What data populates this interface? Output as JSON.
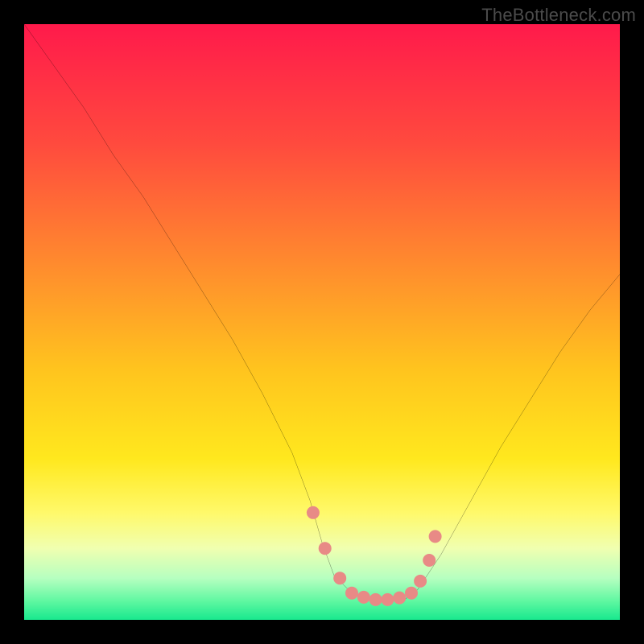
{
  "watermark": "TheBottleneck.com",
  "chart_data": {
    "type": "line",
    "title": "",
    "xlabel": "",
    "ylabel": "",
    "xlim": [
      0,
      100
    ],
    "ylim": [
      0,
      100
    ],
    "gradient_stops": [
      {
        "offset": 0,
        "color": "#ff1a4b"
      },
      {
        "offset": 0.2,
        "color": "#ff4a3e"
      },
      {
        "offset": 0.4,
        "color": "#ff8a2e"
      },
      {
        "offset": 0.58,
        "color": "#ffc41e"
      },
      {
        "offset": 0.73,
        "color": "#ffe81e"
      },
      {
        "offset": 0.82,
        "color": "#fff96a"
      },
      {
        "offset": 0.88,
        "color": "#f0ffb0"
      },
      {
        "offset": 0.93,
        "color": "#b6ffc0"
      },
      {
        "offset": 0.97,
        "color": "#5cf7a0"
      },
      {
        "offset": 1.0,
        "color": "#18e88e"
      }
    ],
    "series": [
      {
        "name": "curve",
        "color": "#000000",
        "x": [
          0,
          5,
          10,
          15,
          20,
          25,
          30,
          35,
          40,
          45,
          48,
          50,
          52,
          55,
          58,
          60,
          62,
          64,
          66,
          70,
          75,
          80,
          85,
          90,
          95,
          100
        ],
        "y": [
          100,
          93,
          86,
          78,
          71,
          63,
          55,
          47,
          38,
          28,
          20,
          13,
          7.5,
          4.5,
          3.5,
          3.3,
          3.3,
          3.5,
          5,
          11,
          20,
          29,
          37,
          45,
          52,
          58
        ]
      }
    ],
    "markers": {
      "color": "#e88a86",
      "radius": 8,
      "points": [
        {
          "x": 48.5,
          "y": 18
        },
        {
          "x": 50.5,
          "y": 12
        },
        {
          "x": 53,
          "y": 7
        },
        {
          "x": 55,
          "y": 4.5
        },
        {
          "x": 57,
          "y": 3.8
        },
        {
          "x": 59,
          "y": 3.4
        },
        {
          "x": 61,
          "y": 3.4
        },
        {
          "x": 63,
          "y": 3.7
        },
        {
          "x": 65,
          "y": 4.5
        },
        {
          "x": 66.5,
          "y": 6.5
        },
        {
          "x": 68,
          "y": 10
        },
        {
          "x": 69,
          "y": 14
        }
      ]
    }
  }
}
